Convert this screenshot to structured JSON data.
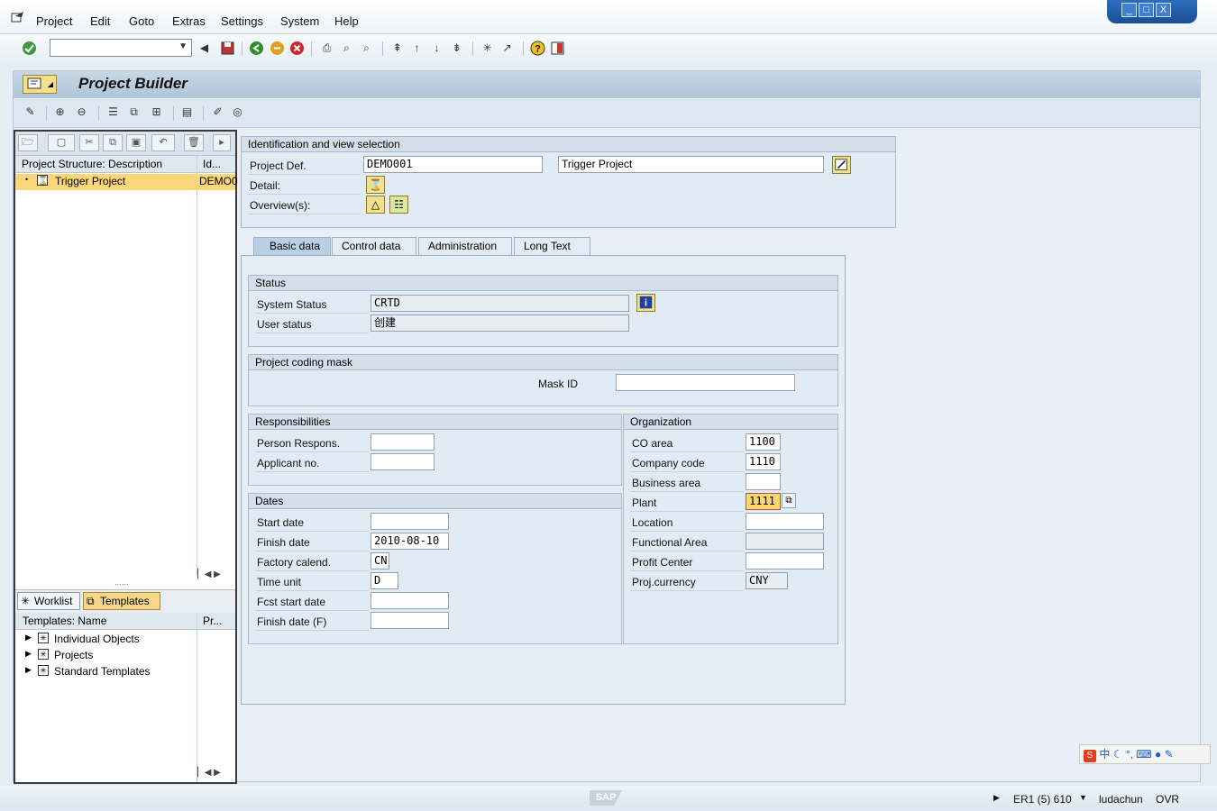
{
  "menu": [
    "Project",
    "Edit",
    "Goto",
    "Extras",
    "Settings",
    "System",
    "Help"
  ],
  "window_controls": [
    "_",
    "□",
    "X"
  ],
  "toolbar": {
    "command_value": ""
  },
  "app": {
    "title": "Project Builder"
  },
  "structure": {
    "col_description": "Project Structure: Description",
    "col_id": "Id...",
    "rows": [
      {
        "description": "Trigger Project",
        "id": "DEMO0"
      }
    ]
  },
  "lower_tabs": {
    "worklist": "Worklist",
    "templates": "Templates"
  },
  "templates": {
    "col_name": "Templates: Name",
    "col_pr": "Pr...",
    "items": [
      "Individual Objects",
      "Projects",
      "Standard Templates"
    ]
  },
  "identification": {
    "title": "Identification and view selection",
    "project_def_label": "Project Def.",
    "project_def_value": "DEMO001",
    "project_desc_value": "Trigger Project",
    "detail_label": "Detail:",
    "overviews_label": "Overview(s):"
  },
  "tabs": [
    "Basic data",
    "Control data",
    "Administration",
    "Long Text"
  ],
  "status": {
    "title": "Status",
    "system_status_label": "System Status",
    "system_status_value": "CRTD",
    "user_status_label": "User status",
    "user_status_value": "创建"
  },
  "coding_mask": {
    "title": "Project coding mask",
    "mask_id_label": "Mask ID",
    "mask_id_value": ""
  },
  "responsibilities": {
    "title": "Responsibilities",
    "person_label": "Person Respons.",
    "person_value": "",
    "applicant_label": "Applicant no.",
    "applicant_value": ""
  },
  "dates": {
    "title": "Dates",
    "start_label": "Start date",
    "start_value": "",
    "finish_label": "Finish date",
    "finish_value": "2010-08-10",
    "calendar_label": "Factory calend.",
    "calendar_value": "CN",
    "time_unit_label": "Time unit",
    "time_unit_value": "D",
    "fcst_start_label": "Fcst start date",
    "fcst_start_value": "",
    "finish_f_label": "Finish date (F)",
    "finish_f_value": ""
  },
  "organization": {
    "title": "Organization",
    "co_area_label": "CO area",
    "co_area_value": "1100",
    "company_code_label": "Company code",
    "company_code_value": "1110",
    "business_area_label": "Business area",
    "business_area_value": "",
    "plant_label": "Plant",
    "plant_value": "1111",
    "location_label": "Location",
    "location_value": "",
    "functional_area_label": "Functional Area",
    "functional_area_value": "",
    "profit_center_label": "Profit Center",
    "profit_center_value": "",
    "currency_label": "Proj.currency",
    "currency_value": "CNY"
  },
  "statusbar": {
    "system": "ER1 (5) 610",
    "user": "ludachun",
    "mode": "OVR",
    "logo": "SAP"
  },
  "ime": {
    "label": "中"
  },
  "colors": {
    "selection": "#fbd67a",
    "highlight_border": "#cc4444",
    "frame": "#e6eef5"
  }
}
